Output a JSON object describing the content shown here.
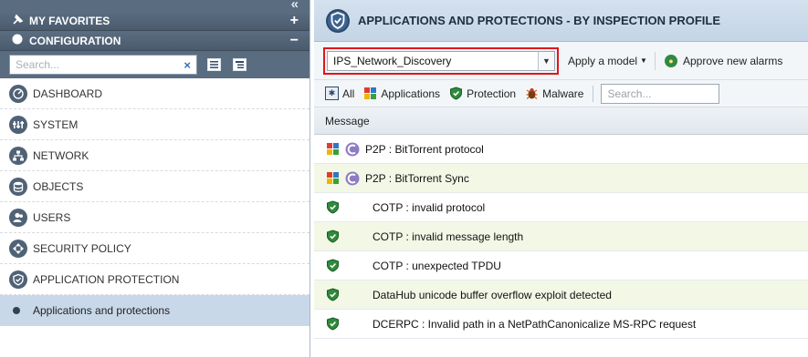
{
  "sidebar": {
    "favorites_label": "MY FAVORITES",
    "favorites_toggle": "+",
    "configuration_label": "CONFIGURATION",
    "configuration_toggle": "−",
    "collapse_glyph": "«",
    "search_placeholder": "Search...",
    "search_clear": "×",
    "items": [
      {
        "label": "DASHBOARD",
        "icon": "dashboard-icon"
      },
      {
        "label": "SYSTEM",
        "icon": "system-icon"
      },
      {
        "label": "NETWORK",
        "icon": "network-icon"
      },
      {
        "label": "OBJECTS",
        "icon": "objects-icon"
      },
      {
        "label": "USERS",
        "icon": "users-icon"
      },
      {
        "label": "SECURITY POLICY",
        "icon": "security-policy-icon"
      },
      {
        "label": "APPLICATION PROTECTION",
        "icon": "shield-icon"
      }
    ],
    "active_sub_item": "Applications and protections"
  },
  "main": {
    "title": "APPLICATIONS AND PROTECTIONS - BY INSPECTION PROFILE",
    "profile_select_value": "IPS_Network_Discovery",
    "apply_model_label": "Apply a model",
    "approve_label": "Approve new alarms",
    "filters": {
      "all": "All",
      "applications": "Applications",
      "protection": "Protection",
      "malware": "Malware"
    },
    "grid_search_placeholder": "Search...",
    "column_message": "Message",
    "rows": [
      {
        "type": "application",
        "message": "P2P : BitTorrent protocol"
      },
      {
        "type": "application",
        "message": "P2P : BitTorrent Sync"
      },
      {
        "type": "protection",
        "message": "COTP : invalid protocol"
      },
      {
        "type": "protection",
        "message": "COTP : invalid message length"
      },
      {
        "type": "protection",
        "message": "COTP : unexpected TPDU"
      },
      {
        "type": "protection",
        "message": "DataHub unicode buffer overflow exploit detected"
      },
      {
        "type": "protection",
        "message": "DCERPC : Invalid path in a NetPathCanonicalize MS-RPC request"
      }
    ]
  },
  "colors": {
    "sidebar_header": "#4a5b6e",
    "highlight_border": "#e0161b",
    "active_item_bg": "#c9d8e8",
    "alt_row_bg": "#f3f8e6"
  }
}
